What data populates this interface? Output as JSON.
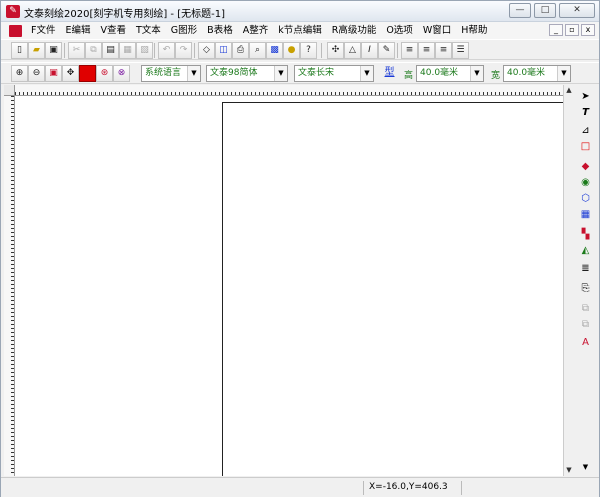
{
  "window": {
    "title": "文泰刻绘2020[刻字机专用刻绘] - [无标题-1]",
    "min_glyph": "—",
    "max_glyph": "□",
    "close_glyph": "✕"
  },
  "menu": {
    "items": [
      "F文件",
      "E编辑",
      "V查看",
      "T文本",
      "G图形",
      "B表格",
      "A整齐",
      "k节点编辑",
      "R高级功能",
      "O选项",
      "W窗口",
      "H帮助"
    ],
    "mdi": {
      "min": "_",
      "restore": "▫",
      "close": "x"
    }
  },
  "toolbar1": {
    "icons": [
      "new-icon",
      "open-icon",
      "save-icon",
      "cut-icon",
      "copy-icon",
      "paste-icon",
      "print-preview-icon",
      "undo-icon",
      "redo-icon",
      "scan-icon",
      "outline-icon",
      "print-icon",
      "find-icon",
      "frame-icon",
      "bulb-icon",
      "help-icon",
      "symbol-icon",
      "shape-icon",
      "italic-icon",
      "edit-text-icon",
      "align-left-icon",
      "align-center-icon",
      "align-right-icon",
      "align-justify-icon"
    ]
  },
  "toolbar2": {
    "language": "系统语言",
    "font": "文泰98简体",
    "style": "文泰长宋",
    "type_button": "型",
    "height_label": "高",
    "height_value": "40.0毫米",
    "width_label": "宽",
    "width_value": "40.0毫米"
  },
  "status": {
    "coords": "X=-16.0,Y=406.3"
  },
  "colors": {
    "accent_red": "#c8102e",
    "combo_text": "#1d7a1d",
    "type_link": "#1a3ad6"
  }
}
